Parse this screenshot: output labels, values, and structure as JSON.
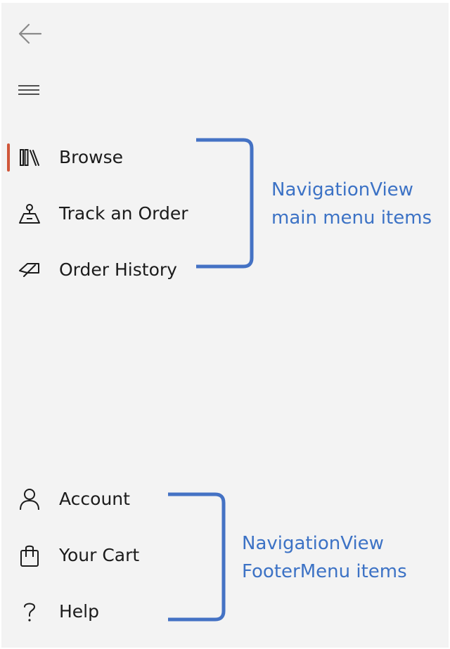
{
  "nav": {
    "main_items": [
      {
        "label": "Browse",
        "icon": "library-icon",
        "selected": true
      },
      {
        "label": "Track an Order",
        "icon": "delivery-icon",
        "selected": false
      },
      {
        "label": "Order History",
        "icon": "tag-icon",
        "selected": false
      }
    ],
    "footer_items": [
      {
        "label": "Account",
        "icon": "person-icon",
        "selected": false
      },
      {
        "label": "Your Cart",
        "icon": "shopping-bag-icon",
        "selected": false
      },
      {
        "label": "Help",
        "icon": "help-icon",
        "selected": false
      }
    ],
    "icons": {
      "back": "back-arrow-icon",
      "menu": "hamburger-icon"
    }
  },
  "annotations": {
    "main": {
      "line1": "NavigationView",
      "line2": "main menu items"
    },
    "footer": {
      "line1": "NavigationView",
      "line2": "FooterMenu items"
    }
  },
  "colors": {
    "pane_background": "#f3f3f3",
    "selection_indicator": "#d0573a",
    "annotation": "#3c72c5",
    "text": "#1b1b1b"
  }
}
